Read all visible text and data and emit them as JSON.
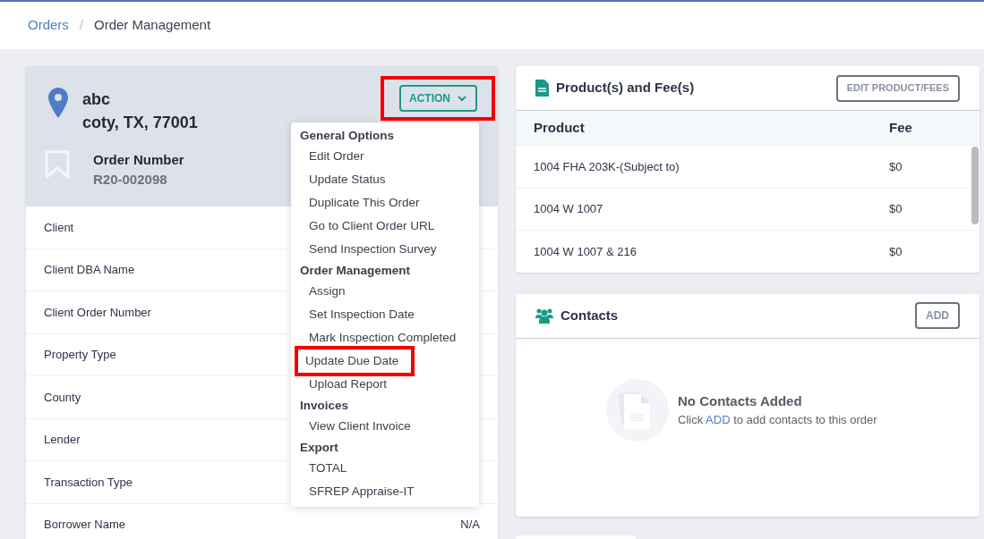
{
  "breadcrumb": [
    {
      "label": "Orders",
      "kind": "link"
    },
    {
      "label": "/",
      "kind": "separator"
    },
    {
      "label": "Order Management",
      "kind": "current"
    }
  ],
  "order": {
    "address_line_1": "abc",
    "address_line_2": "coty, TX, 77001",
    "number_label": "Order Number",
    "number": "R20-002098",
    "action_button": {
      "label": "ACTION",
      "highlighted": true
    }
  },
  "action_menu": {
    "expanded": true,
    "groups": [
      {
        "title": "General Options",
        "items": [
          {
            "label": "Edit Order",
            "highlighted": false
          },
          {
            "label": "Update Status",
            "highlighted": false
          },
          {
            "label": "Duplicate This Order",
            "highlighted": false
          },
          {
            "label": "Go to Client Order URL",
            "highlighted": false
          },
          {
            "label": "Send Inspection Survey",
            "highlighted": false
          }
        ]
      },
      {
        "title": "Order Management",
        "items": [
          {
            "label": "Assign",
            "highlighted": false
          },
          {
            "label": "Set Inspection Date",
            "highlighted": false
          },
          {
            "label": "Mark Inspection Completed",
            "highlighted": false
          },
          {
            "label": "Update Due Date",
            "highlighted": true
          },
          {
            "label": "Upload Report",
            "highlighted": false
          }
        ]
      },
      {
        "title": "Invoices",
        "items": [
          {
            "label": "View Client Invoice",
            "highlighted": false
          }
        ]
      },
      {
        "title": "Export",
        "items": [
          {
            "label": "TOTAL",
            "highlighted": false
          },
          {
            "label": "SFREP Appraise-IT",
            "highlighted": false
          }
        ]
      }
    ]
  },
  "details": [
    {
      "label": "Client"
    },
    {
      "label": "Client DBA Name"
    },
    {
      "label": "Client Order Number"
    },
    {
      "label": "Property Type"
    },
    {
      "label": "County"
    },
    {
      "label": "Lender"
    },
    {
      "label": "Transaction Type"
    },
    {
      "label": "Borrower Name",
      "value": "N/A"
    }
  ],
  "products": {
    "title": "Product(s) and Fee(s)",
    "edit_button": "EDIT PRODUCT/FEES",
    "columns": [
      "Product",
      "Fee"
    ],
    "rows": [
      {
        "product": "1004 FHA 203K-(Subject to)",
        "fee": "$0"
      },
      {
        "product": "1004 W 1007",
        "fee": "$0"
      },
      {
        "product": "1004 W 1007 & 216",
        "fee": "$0"
      }
    ]
  },
  "contacts": {
    "title": "Contacts",
    "add_button": "ADD",
    "empty_title": "No Contacts Added",
    "empty_prefix": "Click",
    "empty_link": "ADD",
    "empty_suffix": "to add contacts to this order"
  }
}
